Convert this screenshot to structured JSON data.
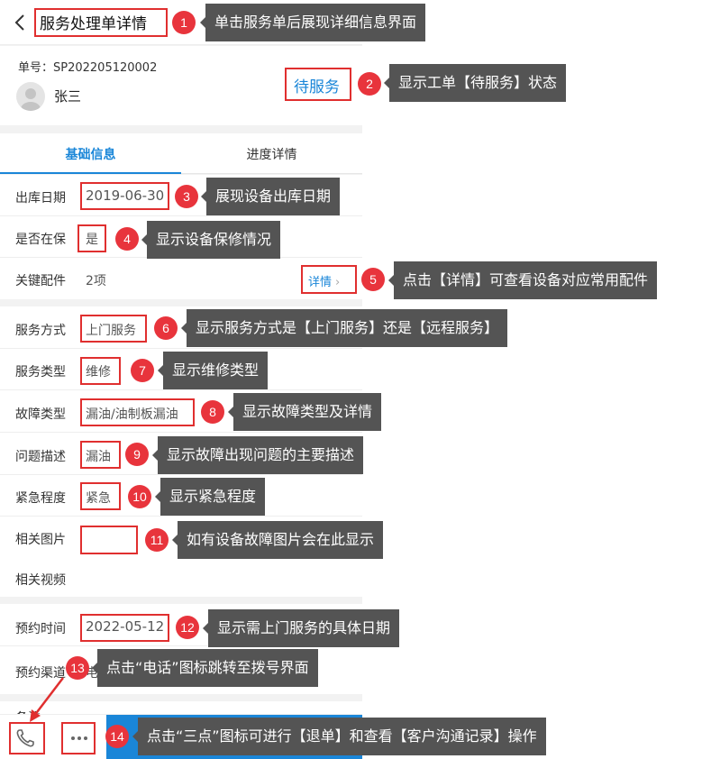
{
  "header": {
    "title": "服务处理单详情"
  },
  "order": {
    "number": "单号：SP202205120002",
    "user_name": "张三",
    "status": "待服务"
  },
  "tabs": [
    {
      "label": "基础信息"
    },
    {
      "label": "进度详情"
    }
  ],
  "fields": {
    "out_date": {
      "label": "出库日期",
      "value": "2019-06-30"
    },
    "warranty": {
      "label": "是否在保",
      "value": "是"
    },
    "key_parts": {
      "label": "关键配件",
      "value": "2项",
      "link": "详情",
      "chevron": "›"
    },
    "service_mode": {
      "label": "服务方式",
      "value": "上门服务"
    },
    "service_type": {
      "label": "服务类型",
      "value": "维修"
    },
    "fault_type": {
      "label": "故障类型",
      "value": "漏油/油制板漏油"
    },
    "problem_desc": {
      "label": "问题描述",
      "value": "漏油"
    },
    "urgency": {
      "label": "紧急程度",
      "value": "紧急"
    },
    "images": {
      "label": "相关图片"
    },
    "videos": {
      "label": "相关视频"
    },
    "appointment_time": {
      "label": "预约时间",
      "value": "2022-05-12"
    },
    "appointment_channel": {
      "label": "预约渠道",
      "value": "电话"
    },
    "remarks": {
      "label": "备注"
    }
  },
  "bottom_bar": {
    "phone_icon": "phone-icon",
    "more_icon": "more-dots-icon"
  },
  "annotations": [
    {
      "n": "1",
      "text": "单击服务单后展现详细信息界面"
    },
    {
      "n": "2",
      "text": "显示工单【待服务】状态"
    },
    {
      "n": "3",
      "text": "展现设备出库日期"
    },
    {
      "n": "4",
      "text": "显示设备保修情况"
    },
    {
      "n": "5",
      "text": "点击【详情】可查看设备对应常用配件"
    },
    {
      "n": "6",
      "text": "显示服务方式是【上门服务】还是【远程服务】"
    },
    {
      "n": "7",
      "text": "显示维修类型"
    },
    {
      "n": "8",
      "text": "显示故障类型及详情"
    },
    {
      "n": "9",
      "text": "显示故障出现问题的主要描述"
    },
    {
      "n": "10",
      "text": "显示紧急程度"
    },
    {
      "n": "11",
      "text": "如有设备故障图片会在此显示"
    },
    {
      "n": "12",
      "text": "显示需上门服务的具体日期"
    },
    {
      "n": "13",
      "text": "点击“电话”图标跳转至拨号界面"
    },
    {
      "n": "14",
      "text": "点击“三点”图标可进行【退单】和查看【客户沟通记录】操作"
    }
  ],
  "colors": {
    "accent": "#1a86d8",
    "annotation_red": "#e02f2f",
    "callout_bg": "#545454",
    "badge": "#e8343c"
  }
}
